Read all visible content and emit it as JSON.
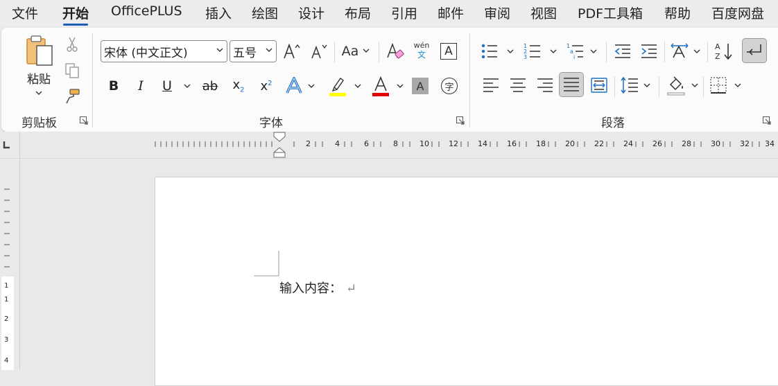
{
  "menu_tabs": [
    "文件",
    "开始",
    "OfficePLUS",
    "插入",
    "绘图",
    "设计",
    "布局",
    "引用",
    "邮件",
    "审阅",
    "视图",
    "PDF工具箱",
    "帮助",
    "百度网盘"
  ],
  "active_tab": "开始",
  "clipboard": {
    "paste_label": "粘贴",
    "group_label": "剪贴板"
  },
  "font": {
    "name": "宋体 (中文正文)",
    "size": "五号",
    "group_label": "字体",
    "case_label": "Aa",
    "phonetic_top": "wén",
    "phonetic_bottom": "文",
    "boxed_char": "A",
    "enclose_char": "字",
    "shade_char": "A",
    "highlight_color": "#ffff00",
    "font_color": "#e00000"
  },
  "paragraph": {
    "group_label": "段落"
  },
  "ruler": {
    "ticks": [
      "2",
      "4",
      "6",
      "8",
      "10",
      "12",
      "14",
      "16",
      "18",
      "20",
      "22",
      "24",
      "26",
      "28",
      "30",
      "32",
      "34"
    ],
    "vticks": [
      "1",
      "1",
      "2",
      "3",
      "4"
    ]
  },
  "document": {
    "text": "输入内容：",
    "para_mark": "↵"
  },
  "colors": {
    "accent": "#1a5fb4"
  }
}
